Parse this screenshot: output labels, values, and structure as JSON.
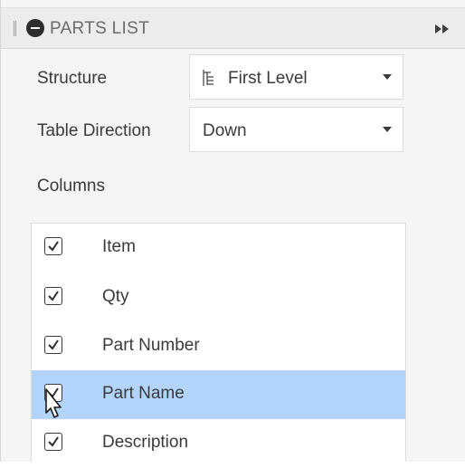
{
  "panel": {
    "title": "PARTS LIST"
  },
  "structure": {
    "label": "Structure",
    "value": "First Level",
    "icon": "tree-structure-icon"
  },
  "table_direction": {
    "label": "Table Direction",
    "value": "Down"
  },
  "columns": {
    "label": "Columns",
    "items": [
      {
        "label": "Item",
        "checked": true,
        "selected": false
      },
      {
        "label": "Qty",
        "checked": true,
        "selected": false
      },
      {
        "label": "Part Number",
        "checked": true,
        "selected": false
      },
      {
        "label": "Part Name",
        "checked": true,
        "selected": true
      },
      {
        "label": "Description",
        "checked": true,
        "selected": false
      }
    ]
  },
  "colors": {
    "selection": "#b3d4fc",
    "header_bg": "#ececec"
  }
}
